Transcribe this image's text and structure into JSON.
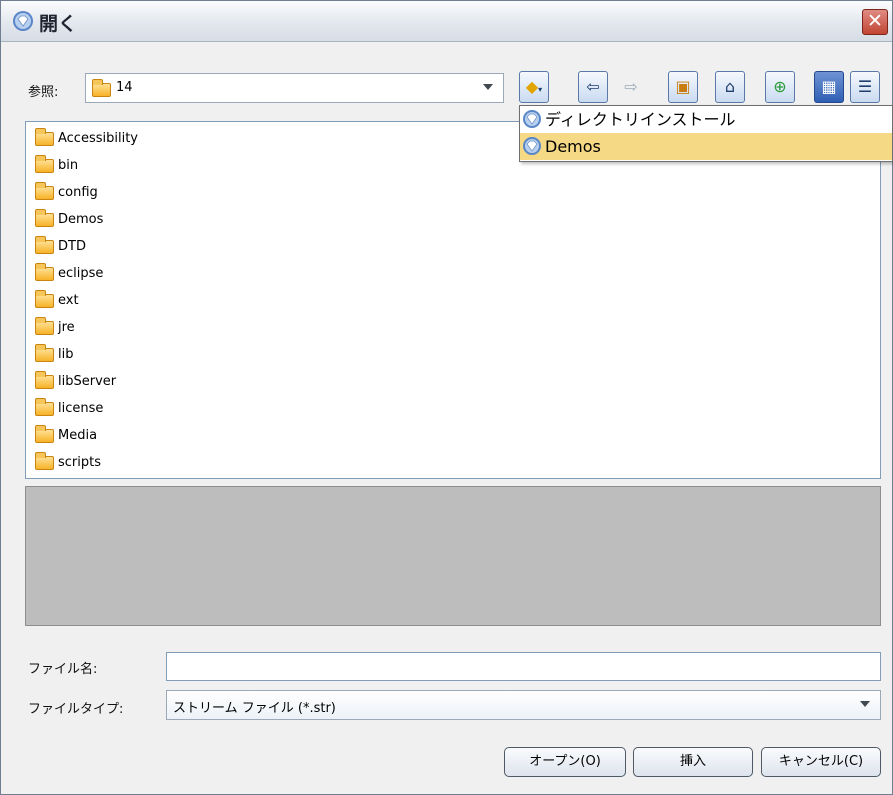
{
  "window": {
    "title": "開く"
  },
  "lookin": {
    "label": "参照:",
    "value": "14"
  },
  "toolbar": {
    "buttons": [
      {
        "name": "favorites-button",
        "icon": "star-diamond-icon"
      },
      {
        "name": "back-button",
        "icon": "arrow-left-icon"
      },
      {
        "name": "forward-button",
        "icon": "arrow-right-icon"
      },
      {
        "name": "up-folder-button",
        "icon": "folder-up-icon"
      },
      {
        "name": "home-button",
        "icon": "home-icon"
      },
      {
        "name": "new-folder-button",
        "icon": "new-folder-icon"
      },
      {
        "name": "list-view-button",
        "icon": "grid-view-icon"
      },
      {
        "name": "details-view-button",
        "icon": "details-view-icon"
      }
    ]
  },
  "files": [
    "Accessibility",
    "bin",
    "config",
    "Demos",
    "DTD",
    "eclipse",
    "ext",
    "jre",
    "lib",
    "libServer",
    "license",
    "Media",
    "scripts"
  ],
  "favorites_menu": [
    {
      "label": "ディレクトリインストール",
      "selected": false
    },
    {
      "label": "Demos",
      "selected": true
    }
  ],
  "filename": {
    "label": "ファイル名:",
    "value": ""
  },
  "filetype": {
    "label": "ファイルタイプ:",
    "value": "ストリーム ファイル (*.str)"
  },
  "buttons": {
    "open": "オープン(O)",
    "insert": "挿入",
    "cancel": "キャンセル(C)"
  },
  "colors": {
    "selection": "#f5d985",
    "folder": "#f7b228",
    "preview": "#bdbdbd"
  }
}
